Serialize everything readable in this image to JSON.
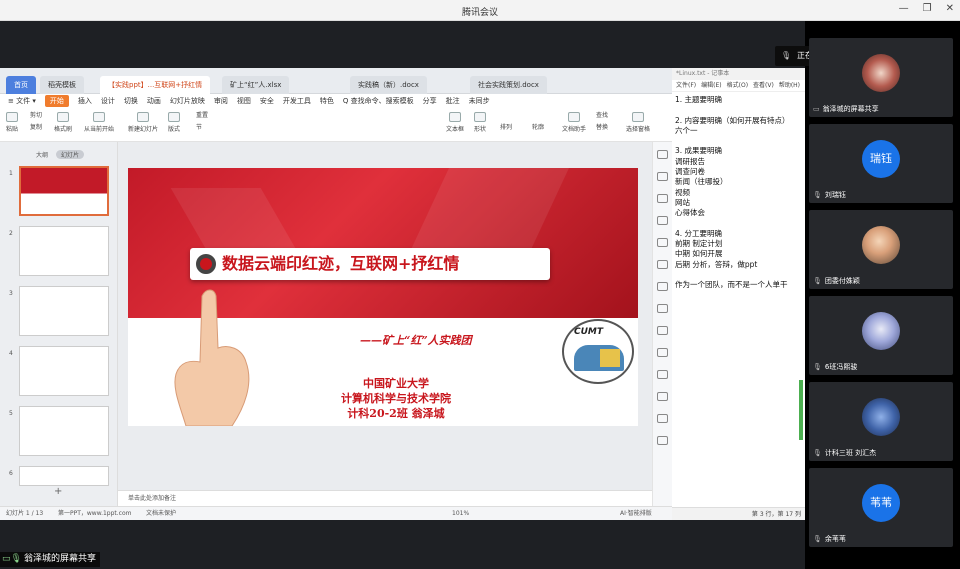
{
  "window": {
    "title": "腾讯会议",
    "controls": [
      "—",
      "❐",
      "✕"
    ]
  },
  "speaking": {
    "label": "正在讲话: 翁泽城;"
  },
  "wps": {
    "tabs": [
      {
        "label": "首页"
      },
      {
        "label": "稻壳模板"
      },
      {
        "label": "【实践ppt】...互联网+抒红情"
      },
      {
        "label": "矿上“红”人.xlsx"
      },
      {
        "label": "实践稿（新）.docx"
      },
      {
        "label": "社会实践策划.docx"
      }
    ],
    "menu": [
      "≡ 文件 ▾",
      "开始",
      "插入",
      "设计",
      "切换",
      "动画",
      "幻灯片放映",
      "审阅",
      "视图",
      "安全",
      "开发工具",
      "特色",
      "Q 查找命令、搜索模板",
      "分享",
      "批注",
      "未同步"
    ],
    "ribbon": [
      "粘贴",
      "剪切",
      "复制",
      "格式刷",
      "从当前开始",
      "新建幻灯片",
      "版式",
      "节",
      "重置",
      "文本框",
      "形状",
      "排列",
      "轮廓",
      "文档助手",
      "查找",
      "替换",
      "选择窗格"
    ],
    "panel_tabs": [
      "大纲",
      "幻灯片"
    ],
    "thumb_numbers": [
      "1",
      "2",
      "3",
      "4",
      "5",
      "6"
    ],
    "slide": {
      "banner": "数据云端印红迹，互联网+抒红情",
      "subtitle": "——矿上“红”人实践团",
      "school_lines": [
        "中国矿业大学",
        "计算机科学与技术学院",
        "计科20-2班 翁泽城"
      ],
      "logo_text": "CUMT"
    },
    "notes_placeholder": "单击此处添加备注",
    "status": {
      "page": "幻灯片 1 / 13",
      "theme": "第一PPT，www.1ppt.com",
      "protect": "文档未保护",
      "zoom": "101%",
      "ai": "AI·智能排版"
    }
  },
  "notepad": {
    "title": "*Linux.txt - 记事本",
    "menu": [
      "文件(F)",
      "编辑(E)",
      "格式(O)",
      "查看(V)",
      "帮助(H)"
    ],
    "lines": [
      "1. 主题要明确",
      "",
      "2. 内容要明确（如何开展有特点）",
      "六个一",
      "",
      "3. 成果要明确",
      "调研报告",
      "调查问卷",
      "新闻（往哪投）",
      "视频",
      "网站",
      "心得体会",
      "",
      "4. 分工要明确",
      "前期 制定计划",
      "中期 如何开展",
      "后期 分析，答辩，做ppt",
      "",
      "作为一个团队，而不是一个人单干"
    ],
    "status": "第 3 行，第 17 列"
  },
  "participants": [
    {
      "name": "翁泽城的屏幕共享",
      "avatar": "photo"
    },
    {
      "name": "刘瑞钰",
      "avatar": "瑞钰"
    },
    {
      "name": "团委付姝颖",
      "avatar": "photo"
    },
    {
      "name": "6班冯熙骏",
      "avatar": "photo"
    },
    {
      "name": "计科三班 刘汇杰",
      "avatar": "photo"
    },
    {
      "name": "余苇苇",
      "avatar": "苇苇"
    }
  ],
  "bottom_label": "翁泽城的屏幕共享",
  "colors": {
    "accent": "#1a73e8",
    "slide_red": "#c8161d",
    "wps_orange": "#f07c2d"
  }
}
